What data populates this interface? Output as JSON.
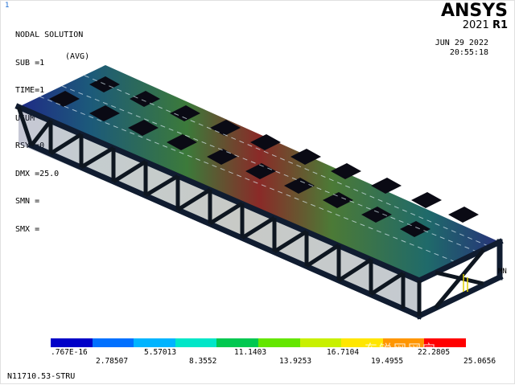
{
  "window": {
    "number": "1"
  },
  "solution_info": {
    "title": "NODAL SOLUTION",
    "lines": [
      "SUB =1",
      "TIME=1",
      "USUM",
      "RSYS=0",
      "DMX =25.0",
      "SMN =",
      "SMX ="
    ],
    "avg_tag": "(AVG)"
  },
  "brand": {
    "name": "ANSYS",
    "version_year": "2021",
    "version_release": "R1"
  },
  "timestamp": {
    "date": "JUN 29 2022",
    "time": "20:55:18"
  },
  "node_label": "MN",
  "legend": {
    "colors": [
      "#0000c8",
      "#0070ff",
      "#00b4ff",
      "#00e6c8",
      "#00c850",
      "#64e600",
      "#c8f000",
      "#ffe600",
      "#ff9600",
      "#ff0000"
    ],
    "top_labels": [
      ".767E-16",
      "5.57013",
      "11.1403",
      "16.7104",
      "22.2805"
    ],
    "bottom_labels": [
      "2.78507",
      "8.3552",
      "13.9253",
      "19.4955",
      "25.0656"
    ]
  },
  "watermark": "东锐网网完",
  "footer": "N11710.53-STRU"
}
